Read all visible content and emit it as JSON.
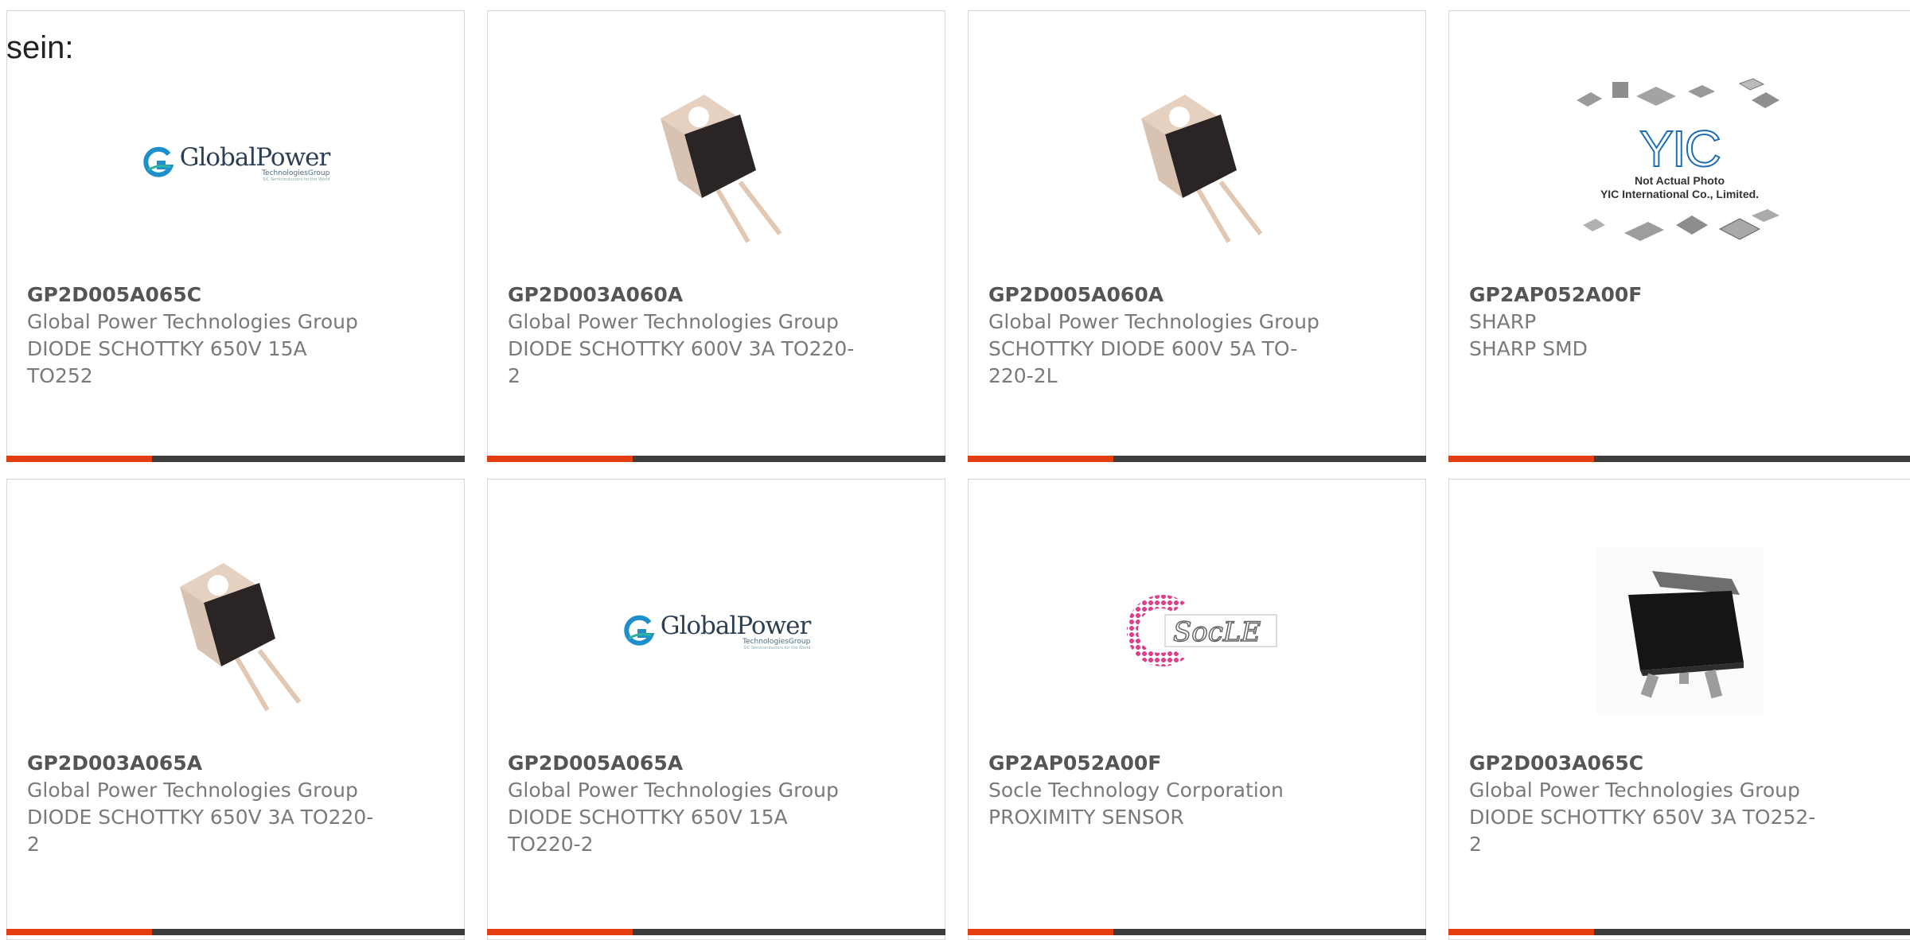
{
  "page_label": "sein:",
  "colors": {
    "accent": "#e43d0f",
    "bar": "#3d3d3d",
    "border": "#d6d6d6"
  },
  "products": [
    {
      "part_number": "GP2D005A065C",
      "manufacturer": "Global Power Technologies Group",
      "description": "DIODE SCHOTTKY 650V 15A TO252",
      "image": "globalpower-logo"
    },
    {
      "part_number": "GP2D003A060A",
      "manufacturer": "Global Power Technologies Group",
      "description": "DIODE SCHOTTKY 600V 3A TO220-2",
      "image": "to220-diode-photo"
    },
    {
      "part_number": "GP2D005A060A",
      "manufacturer": "Global Power Technologies Group",
      "description": "SCHOTTKY DIODE 600V 5A TO-220-2L",
      "image": "to220-diode-photo"
    },
    {
      "part_number": "GP2AP052A00F",
      "manufacturer": "SHARP",
      "description": "SHARP SMD",
      "image": "yic-not-actual-photo",
      "image_text": [
        "Not Actual Photo",
        "YIC International Co., Limited."
      ]
    },
    {
      "part_number": "GP2D003A065A",
      "manufacturer": "Global Power Technologies Group",
      "description": "DIODE SCHOTTKY 650V 3A TO220-2",
      "image": "to220-diode-photo"
    },
    {
      "part_number": "GP2D005A065A",
      "manufacturer": "Global Power Technologies Group",
      "description": "DIODE SCHOTTKY 650V 15A TO220-2",
      "image": "globalpower-logo"
    },
    {
      "part_number": "GP2AP052A00F",
      "manufacturer": "Socle Technology Corporation",
      "description": "PROXIMITY SENSOR",
      "image": "socle-logo"
    },
    {
      "part_number": "GP2D003A065C",
      "manufacturer": "Global Power Technologies Group",
      "description": "DIODE SCHOTTKY 650V 3A TO252-2",
      "image": "to252-dpak-photo"
    }
  ],
  "logos": {
    "globalpower": {
      "word": "GlobalPower",
      "sub": "TechnologiesGroup",
      "tagline": "SiC Semiconductors for the World"
    },
    "socle": {
      "word": "SocLE"
    }
  }
}
